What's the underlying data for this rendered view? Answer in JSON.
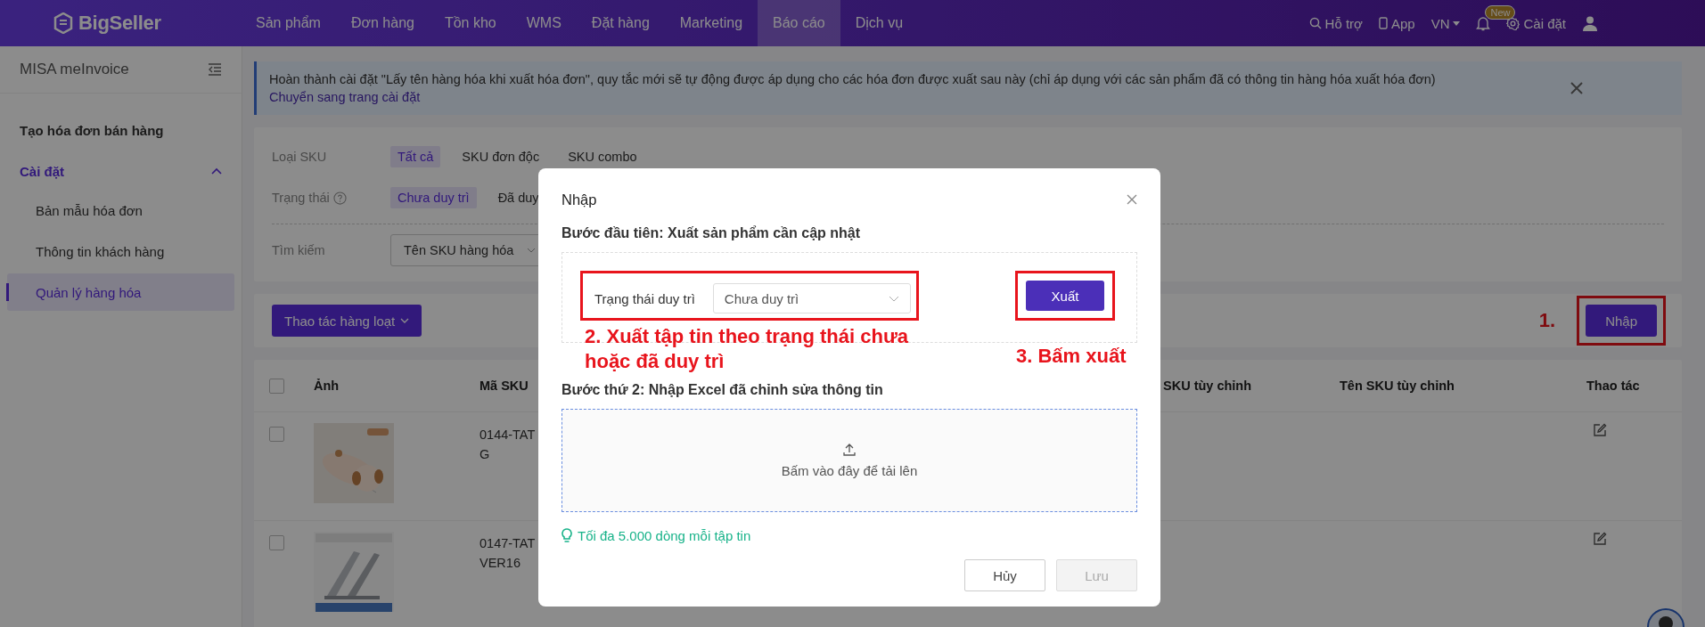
{
  "top_nav": {
    "logo": "BigSeller",
    "items": [
      {
        "label": "Sản phẩm",
        "selected": false
      },
      {
        "label": "Đơn hàng",
        "selected": false
      },
      {
        "label": "Tồn kho",
        "selected": false
      },
      {
        "label": "WMS",
        "selected": false
      },
      {
        "label": "Đặt hàng",
        "selected": false
      },
      {
        "label": "Marketing",
        "selected": false
      },
      {
        "label": "Báo cáo",
        "selected": true
      },
      {
        "label": "Dịch vụ",
        "selected": false
      }
    ],
    "help": "Hỗ trợ",
    "app": "App",
    "language": "VN",
    "notification_badge": "New",
    "settings": "Cài đặt"
  },
  "sidebar": {
    "title": "MISA meInvoice",
    "items": [
      {
        "kind": "link",
        "label": "Tạo hóa đơn bán hàng",
        "selected": false
      },
      {
        "kind": "group",
        "label": "Cài đặt",
        "expanded": true,
        "children": [
          {
            "label": "Bản mẫu hóa đơn",
            "selected": false
          },
          {
            "label": "Thông tin khách hàng",
            "selected": false
          },
          {
            "label": "Quản lý hàng hóa",
            "selected": true
          }
        ]
      }
    ]
  },
  "alert": {
    "text": "Hoàn thành cài đặt \"Lấy tên hàng hóa khi xuất hóa đơn\", quy tắc mới sẽ tự động được áp dụng cho các hóa đơn được xuất sau này (chỉ áp dụng với các sản phẩm đã có thông tin hàng hóa xuất hóa đơn)",
    "link": "Chuyển sang trang cài đặt"
  },
  "filters": [
    {
      "label": "Loại SKU",
      "kind": "plain",
      "options": [
        {
          "label": "Tất cả",
          "selected": true
        },
        {
          "label": "SKU đơn độc",
          "selected": false
        },
        {
          "label": "SKU combo",
          "selected": false
        }
      ]
    },
    {
      "label": "Trạng thái",
      "kind": "with-help",
      "options": [
        {
          "label": "Chưa duy trì",
          "selected": true
        },
        {
          "label": "Đã duy",
          "selected": false
        }
      ]
    }
  ],
  "search": {
    "label": "Tìm kiếm",
    "field": "Tên SKU hàng hóa"
  },
  "toolbar": {
    "bulk_button": "Thao tác hàng loạt",
    "import_button": "Nhập"
  },
  "table": {
    "all_checked": false,
    "columns": [
      "Ảnh",
      "Mã SKU",
      "SKU tùy chỉnh",
      "Tên SKU tùy chỉnh",
      "Thao tác"
    ],
    "rows": [
      {
        "checked": false,
        "picture": {
          "kind": "picture"
        },
        "sku_lines": [
          "0144-TAT",
          "G"
        ]
      },
      {
        "checked": false,
        "picture": {
          "kind": "picture"
        },
        "sku_lines": [
          "0147-TAT",
          "VER16"
        ]
      }
    ]
  },
  "modal": {
    "title": "Nhập",
    "step_1": "Bước đầu tiên: Xuất sản phẩm cần cập nhật",
    "status_label": "Trạng thái duy trì",
    "status_value": "Chưa duy trì",
    "export_button": "Xuất",
    "step_2": "Bước thứ 2: Nhập Excel đã chỉnh sửa thông tin",
    "upload_text": "Bấm vào đây để tải lên",
    "hint": "Tối đa 5.000 dòng mỗi tập tin",
    "cancel_button": "Hủy",
    "save_button": {
      "label": "Lưu",
      "disabled": true
    }
  },
  "annotations": [
    {
      "text": "1."
    },
    {
      "text": "2. Xuất tập tin theo trạng thái chưa hoặc đã duy trì"
    },
    {
      "text": "3. Bấm xuất"
    }
  ]
}
